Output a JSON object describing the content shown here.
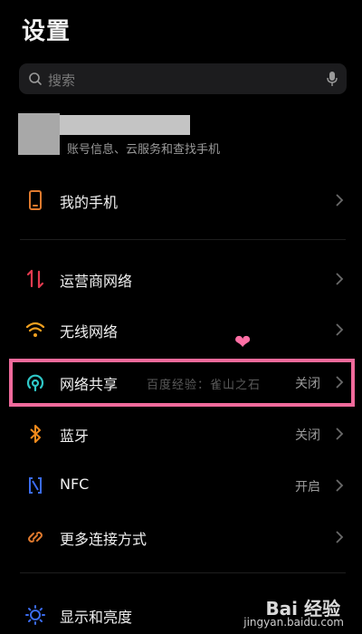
{
  "header": {
    "title": "设置"
  },
  "search": {
    "placeholder": "搜索",
    "icon": "search-icon",
    "mic_icon": "mic-icon"
  },
  "account": {
    "subtitle": "账号信息、云服务和查找手机"
  },
  "items": [
    {
      "label": "我的手机",
      "value": "",
      "icon": "phone-icon",
      "color": "#e07a2e"
    },
    {
      "label": "运营商网络",
      "value": "",
      "icon": "cellular-arrows-icon",
      "color": "#e23a4f"
    },
    {
      "label": "无线网络",
      "value": "",
      "icon": "wifi-icon",
      "color": "#f0a020"
    },
    {
      "label": "网络共享",
      "value": "关闭",
      "icon": "hotspot-icon",
      "color": "#2fc7c7"
    },
    {
      "label": "蓝牙",
      "value": "关闭",
      "icon": "bluetooth-icon",
      "color": "#f08a1c"
    },
    {
      "label": "NFC",
      "value": "开启",
      "icon": "nfc-icon",
      "color": "#3b6cf0"
    },
    {
      "label": "更多连接方式",
      "value": "",
      "icon": "link-icon",
      "color": "#e07a2e"
    },
    {
      "label": "显示和亮度",
      "value": "",
      "icon": "brightness-icon",
      "color": "#3b6cf0"
    }
  ],
  "overlay": {
    "inline_watermark": "百度经验：雀山之石",
    "heart": "❤",
    "highlight_color": "#f06a9b",
    "baidu_logo": "Bai 经验",
    "baidu_url": "jingyan.baidu.com"
  }
}
